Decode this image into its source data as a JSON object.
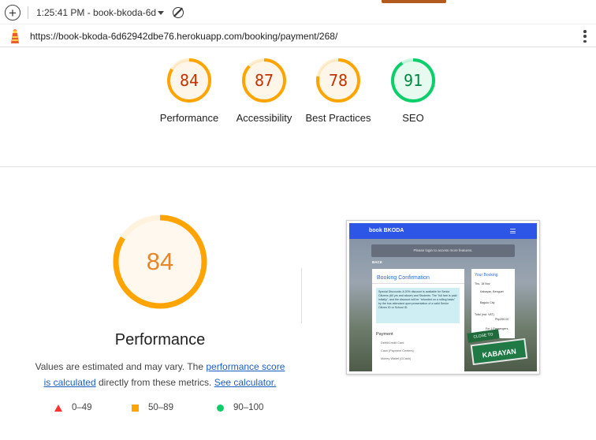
{
  "toolbar": {
    "report_title": "1:25:41 PM - book-bkoda-6d",
    "url": "https://book-bkoda-6d62942dbe76.herokuapp.com/booking/payment/268/"
  },
  "scores": [
    {
      "label": "Performance",
      "value": 84,
      "status": "average"
    },
    {
      "label": "Accessibility",
      "value": 87,
      "status": "average"
    },
    {
      "label": "Best Practices",
      "value": 78,
      "status": "average"
    },
    {
      "label": "SEO",
      "value": 91,
      "status": "pass"
    }
  ],
  "colors": {
    "average": "#ffa400",
    "average_text": "#c33300",
    "pass": "#0cce6b",
    "pass_text": "#018642",
    "fail": "#ff3333",
    "link": "#1a5fbf"
  },
  "details": {
    "category": "Performance",
    "score": 84,
    "desc_prefix": "Values are estimated and may vary. The ",
    "desc_link1": "performance score is calculated",
    "desc_middle": " directly from these metrics. ",
    "desc_link2": "See calculator."
  },
  "legend": [
    {
      "range": "0–49",
      "shape": "triangle-icon"
    },
    {
      "range": "50–89",
      "shape": "square-icon"
    },
    {
      "range": "90–100",
      "shape": "circle-icon"
    }
  ],
  "thumbnail": {
    "brand": "book BKODA",
    "banner": "Please login to access more features.",
    "back": "BACK",
    "card_title": "Booking Confirmation",
    "note": "Special Discounts: A 20% discount is available for Senior Citizens (60 yrs and above) and Students. The \"full fare is paid initially\", and the discount will be \"refunded on a rolling basis\" by the bus attendant upon presentation of a valid Senior Citizen ID or School ID.",
    "payment_title": "Payment",
    "options": [
      "Debit/Credit Card",
      "Cash (Payment Centers)",
      "Money Wallet (GCash)"
    ],
    "side_title": "Your Booking",
    "side_date": "Thu, 18 Nov",
    "side_from": "Kabayan, Benguet",
    "side_to": "Baguio City",
    "side_total": "Total (incl. VAT)",
    "side_price": "Php250.00",
    "side_pax": "For 1 Passengers",
    "sign_big": "KABAYAN",
    "sign_small": "CLOSE TO"
  }
}
